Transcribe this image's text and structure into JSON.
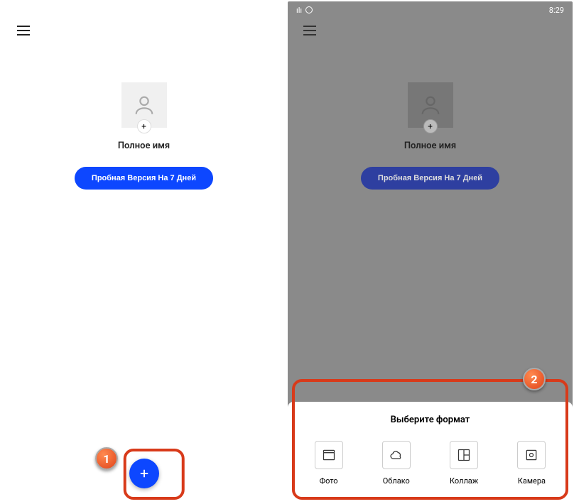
{
  "statusBar": {
    "time": "8:29"
  },
  "profile": {
    "fullNameLabel": "Полное имя",
    "addIcon": "+"
  },
  "trialButton": {
    "label": "Пробная Версия На 7 Дней"
  },
  "fab": {
    "icon": "+"
  },
  "bottomSheet": {
    "title": "Выберите формат",
    "items": [
      {
        "label": "Фото"
      },
      {
        "label": "Облако"
      },
      {
        "label": "Коллаж"
      },
      {
        "label": "Камера"
      }
    ]
  },
  "markers": {
    "one": "1",
    "two": "2"
  }
}
